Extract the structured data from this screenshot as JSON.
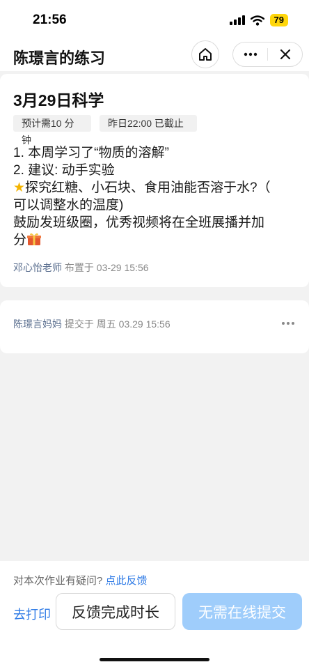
{
  "status_bar": {
    "time": "21:56",
    "battery": "79"
  },
  "nav": {
    "title": "陈璟言的练习"
  },
  "homework": {
    "title": "3月29日科学",
    "tags": [
      "预计需10 分钟",
      "昨日22:00 已截止"
    ],
    "content_lines": [
      "1. 本周学习了“物质的溶解”",
      "2. 建议: 动手实验",
      "探究红糖、小石块、食用油能否溶于水?（",
      "可以调整水的温度)",
      "鼓励发班级圈，优秀视频将在全班展播并加",
      "分"
    ],
    "teacher": "邓心怡老师",
    "assigned_text": "布置于 03-29 15:56"
  },
  "submission": {
    "parent": "陈璟言妈妈",
    "submitted_text": "提交于  周五 03.29 15:56"
  },
  "bottom": {
    "question": "对本次作业有疑问?",
    "feedback_link": "点此反馈",
    "print_label": "去打印",
    "feedback_duration_label": "反馈完成时长",
    "no_submit_label": "无需在线提交"
  },
  "colors": {
    "accent": "#2f7be6",
    "submit_disabled": "#9fcdfb",
    "battery": "#ffd60a"
  }
}
